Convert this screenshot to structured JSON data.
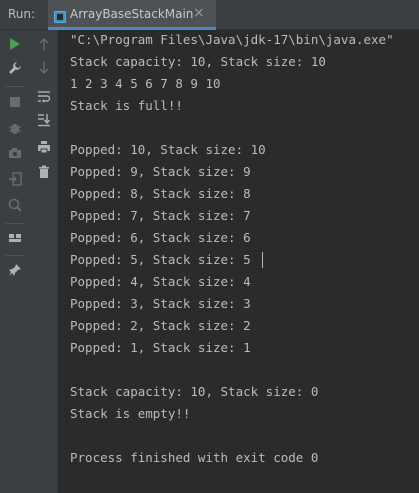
{
  "header": {
    "run_label": "Run:",
    "tab_title": "ArrayBaseStackMain",
    "tab_close": "×"
  },
  "toolbar": {
    "left": [
      {
        "name": "run-icon",
        "color": "#499c54"
      },
      {
        "name": "wrench-icon",
        "color": "#afb1b3"
      },
      {
        "name": "stop-icon",
        "color": "#6b6b6b"
      },
      {
        "name": "debug-bug-icon",
        "color": "#6b6b6b"
      },
      {
        "name": "camera-icon",
        "color": "#6b6b6b"
      },
      {
        "name": "login-icon",
        "color": "#6b6b6b"
      },
      {
        "name": "settings-icon",
        "color": "#6b6b6b"
      },
      {
        "name": "layout-icon",
        "color": "#afb1b3"
      },
      {
        "name": "pin-icon",
        "color": "#afb1b3"
      }
    ],
    "right": [
      {
        "name": "arrow-up-icon"
      },
      {
        "name": "arrow-down-icon"
      },
      {
        "name": "soft-wrap-icon"
      },
      {
        "name": "scroll-to-end-icon"
      },
      {
        "name": "print-icon"
      },
      {
        "name": "trash-icon"
      }
    ]
  },
  "console": {
    "lines": [
      "\"C:\\Program Files\\Java\\jdk-17\\bin\\java.exe\"",
      "Stack capacity: 10, Stack size: 10",
      "1 2 3 4 5 6 7 8 9 10",
      "Stack is full!!",
      "",
      "Popped: 10, Stack size: 10",
      "Popped: 9, Stack size: 9",
      "Popped: 8, Stack size: 8",
      "Popped: 7, Stack size: 7",
      "Popped: 6, Stack size: 6",
      "Popped: 5, Stack size: 5",
      "Popped: 4, Stack size: 4",
      "Popped: 3, Stack size: 3",
      "Popped: 2, Stack size: 2",
      "Popped: 1, Stack size: 1",
      "",
      "Stack capacity: 10, Stack size: 0",
      "Stack is empty!!",
      "",
      "Process finished with exit code 0"
    ]
  },
  "colors": {
    "background": "#2b2b2b",
    "panel": "#3c3f41",
    "text": "#bbbbbb",
    "accent": "#4a88c7"
  }
}
